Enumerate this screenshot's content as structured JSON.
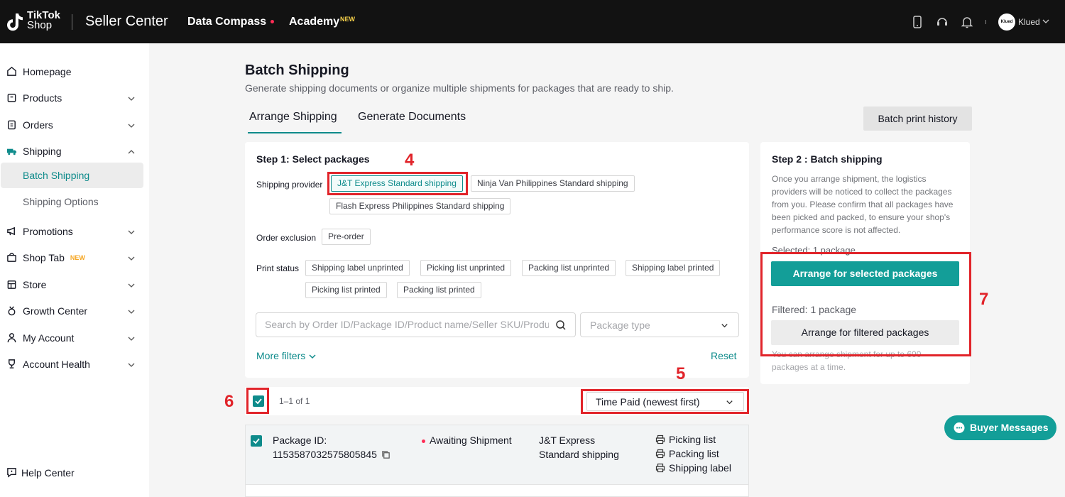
{
  "topbar": {
    "logo_line1": "TikTok",
    "logo_line2": "Shop",
    "title": "Seller Center",
    "nav_data": "Data Compass",
    "nav_academy": "Academy",
    "academy_badge": "NEW",
    "user_avatar_text": "Klued",
    "user_name": "Klued"
  },
  "sidebar": {
    "items": [
      {
        "label": "Homepage",
        "icon": "home-icon"
      },
      {
        "label": "Products",
        "icon": "box-icon"
      },
      {
        "label": "Orders",
        "icon": "clipboard-icon"
      },
      {
        "label": "Shipping",
        "icon": "truck-icon"
      },
      {
        "label": "Promotions",
        "icon": "megaphone-icon"
      },
      {
        "label": "Shop Tab",
        "icon": "shop-icon",
        "badge": "NEW"
      },
      {
        "label": "Store",
        "icon": "store-icon"
      },
      {
        "label": "Growth Center",
        "icon": "medal-icon"
      },
      {
        "label": "My Account",
        "icon": "person-icon"
      },
      {
        "label": "Account Health",
        "icon": "trophy-icon"
      }
    ],
    "sub_items": [
      "Batch Shipping",
      "Shipping Options"
    ],
    "help": "Help Center"
  },
  "page": {
    "title": "Batch Shipping",
    "subtitle": "Generate shipping documents or organize multiple shipments for packages that are ready to ship.",
    "tabs": [
      "Arrange Shipping",
      "Generate Documents"
    ],
    "history_button": "Batch print history"
  },
  "step1": {
    "title": "Step 1: Select packages",
    "provider_label": "Shipping provider",
    "providers": [
      "J&T Express Standard shipping",
      "Ninja Van Philippines Standard shipping",
      "Flash Express Philippines Standard shipping"
    ],
    "exclusion_label": "Order exclusion",
    "exclusion": "Pre-order",
    "print_status_label": "Print status",
    "print_status": [
      "Shipping label unprinted",
      "Picking list unprinted",
      "Packing list unprinted",
      "Shipping label printed",
      "Picking list printed",
      "Packing list printed"
    ],
    "search_placeholder": "Search by Order ID/Package ID/Product name/Seller SKU/Product ID",
    "package_type_placeholder": "Package type",
    "more_filters": "More filters",
    "reset": "Reset"
  },
  "list": {
    "count": "1–1 of 1",
    "sort": "Time Paid (newest first)",
    "package": {
      "id_label": "Package ID:",
      "id": "1153587032575805845",
      "status": "Awaiting Shipment",
      "carrier_line1": "J&T Express",
      "carrier_line2": "Standard shipping",
      "docs": [
        "Picking list",
        "Packing list",
        "Shipping label"
      ]
    }
  },
  "step2": {
    "title": "Step 2 : Batch shipping",
    "description": "Once you arrange shipment, the logistics providers will be noticed to collect the packages from you. Please confirm that all packages have been picked and packed, to ensure your shop's performance score is not affected.",
    "selected": "Selected: 1 package",
    "arrange_selected": "Arrange for selected packages",
    "filtered": "Filtered: 1 package",
    "arrange_filtered": "Arrange for filtered packages",
    "limit_note": "You can arrange shipment for up to 600 packages at a time."
  },
  "annotations": [
    "4",
    "5",
    "6",
    "7"
  ],
  "buyer_messages": "Buyer Messages",
  "colors": {
    "accent": "#0e8b8b",
    "button": "#139e98",
    "annotation": "#e1242a",
    "topbar": "#121212"
  }
}
